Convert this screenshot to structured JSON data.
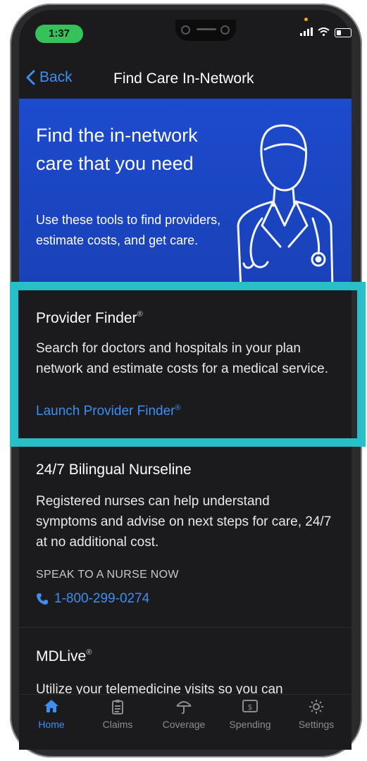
{
  "status": {
    "time": "1:37"
  },
  "nav": {
    "back_label": "Back",
    "title": "Find Care In-Network"
  },
  "hero": {
    "heading": "Find the in-network care that you need",
    "subtext": "Use these tools to find providers, estimate costs, and get care."
  },
  "provider_finder": {
    "title": "Provider Finder",
    "registered": "®",
    "description": "Search for doctors and hospitals in your plan network and estimate costs for a medical service.",
    "link_label": "Launch Provider Finder",
    "link_registered": "®"
  },
  "nurseline": {
    "title": "24/7 Bilingual Nurseline",
    "description": "Registered nurses can help understand symptoms and advise on next steps for care, 24/7 at no additional cost.",
    "cta_label": "SPEAK TO A NURSE NOW",
    "phone": "1-800-299-0274"
  },
  "mdlive": {
    "title": "MDLive",
    "registered": "®",
    "description": "Utilize your telemedicine visits so you can"
  },
  "tabs": [
    {
      "label": "Home",
      "icon": "home-icon",
      "active": true
    },
    {
      "label": "Claims",
      "icon": "clipboard-icon",
      "active": false
    },
    {
      "label": "Coverage",
      "icon": "umbrella-icon",
      "active": false
    },
    {
      "label": "Spending",
      "icon": "dollar-card-icon",
      "active": false
    },
    {
      "label": "Settings",
      "icon": "gear-icon",
      "active": false
    }
  ],
  "colors": {
    "accent": "#3d8ef0",
    "hero": "#1c4bcd",
    "highlight": "#29bfc9",
    "background": "#1b1b1d"
  }
}
